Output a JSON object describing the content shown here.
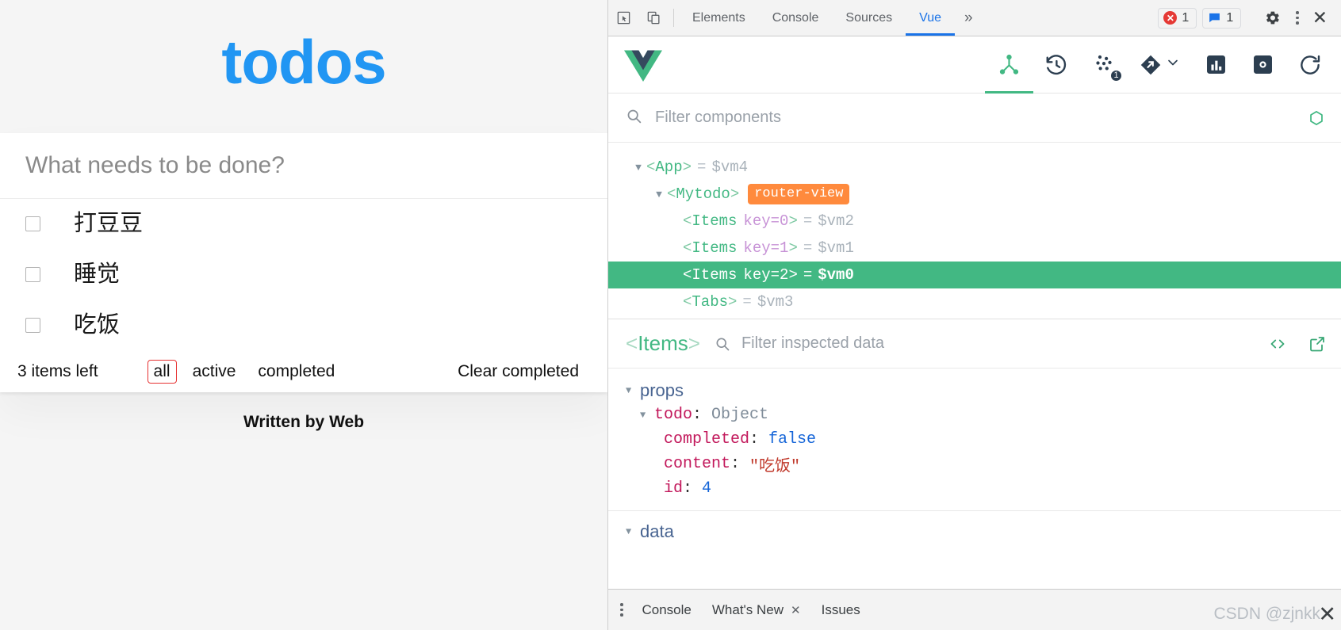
{
  "todo_app": {
    "title": "todos",
    "new_todo_placeholder": "What needs to be done?",
    "items": [
      {
        "label": "打豆豆",
        "completed": false
      },
      {
        "label": "睡觉",
        "completed": false
      },
      {
        "label": "吃饭",
        "completed": false
      }
    ],
    "count_text": "3 items left",
    "filters": [
      {
        "label": "all",
        "selected": true
      },
      {
        "label": "active",
        "selected": false
      },
      {
        "label": "completed",
        "selected": false
      }
    ],
    "clear_completed_label": "Clear completed",
    "written_by": "Written by Web",
    "accent_color": "#2196f3",
    "selected_filter_border": "#e63232"
  },
  "devtools": {
    "topbar": {
      "tabs": [
        {
          "label": "Elements",
          "active": false
        },
        {
          "label": "Console",
          "active": false
        },
        {
          "label": "Sources",
          "active": false
        },
        {
          "label": "Vue",
          "active": true
        }
      ],
      "more_label": "»",
      "error_count": "1",
      "message_count": "1",
      "active_tab_color": "#1a73e8"
    },
    "vue_toolbar": {
      "logo": "vue-logo",
      "buttons": [
        {
          "name": "components-tab",
          "icon": "components-tree-icon",
          "active": true,
          "badge": ""
        },
        {
          "name": "timeline-tab",
          "icon": "history-clock-icon",
          "active": false,
          "badge": ""
        },
        {
          "name": "pinia-tab",
          "icon": "scattered-dots-icon",
          "active": false,
          "badge": "1"
        },
        {
          "name": "routes-tab",
          "icon": "diamond-arrow-icon",
          "active": false,
          "badge": ""
        },
        {
          "name": "performance-tab",
          "icon": "bar-chart-icon",
          "active": false,
          "badge": ""
        },
        {
          "name": "settings-tab",
          "icon": "gear-icon",
          "active": false,
          "badge": ""
        },
        {
          "name": "refresh-button",
          "icon": "refresh-icon",
          "active": false,
          "badge": ""
        }
      ],
      "accent_color": "#42b883"
    },
    "component_filter": {
      "placeholder": "Filter components",
      "search_icon": "search-icon",
      "select_icon": "target-select-icon"
    },
    "tree": [
      {
        "indent": 0,
        "arrow": "▼",
        "name": "App",
        "key": "",
        "vm": "$vm4",
        "badge": "",
        "selected": false
      },
      {
        "indent": 1,
        "arrow": "▼",
        "name": "Mytodo",
        "key": "",
        "vm": "",
        "badge": "router-view",
        "selected": false
      },
      {
        "indent": 2,
        "arrow": "",
        "name": "Items",
        "key": "key=0",
        "vm": "$vm2",
        "badge": "",
        "selected": false
      },
      {
        "indent": 2,
        "arrow": "",
        "name": "Items",
        "key": "key=1",
        "vm": "$vm1",
        "badge": "",
        "selected": false
      },
      {
        "indent": 2,
        "arrow": "",
        "name": "Items",
        "key": "key=2",
        "vm": "$vm0",
        "badge": "",
        "selected": true
      },
      {
        "indent": 2,
        "arrow": "",
        "name": "Tabs",
        "key": "",
        "vm": "$vm3",
        "badge": "",
        "selected": false
      }
    ],
    "inspector": {
      "component_name": "Items",
      "open_bracket": "<",
      "close_bracket": ">",
      "filter_placeholder": "Filter inspected data",
      "search_icon": "search-icon",
      "code_icon": "code-brackets-icon",
      "open_external_icon": "open-in-new-icon",
      "groups": [
        {
          "label": "props",
          "arrow": "▼",
          "rows": [
            {
              "indent": 1,
              "arrow": "▼",
              "key": "todo",
              "colon": ":",
              "value": "Object",
              "vtype": "obj"
            },
            {
              "indent": 2,
              "arrow": "",
              "key": "completed",
              "colon": ":",
              "value": "false",
              "vtype": "bool"
            },
            {
              "indent": 2,
              "arrow": "",
              "key": "content",
              "colon": ":",
              "value": "\"吃饭\"",
              "vtype": "str"
            },
            {
              "indent": 2,
              "arrow": "",
              "key": "id",
              "colon": ":",
              "value": "4",
              "vtype": "num"
            }
          ]
        },
        {
          "label": "data",
          "arrow": "▼",
          "rows": []
        }
      ]
    },
    "drawer": {
      "kebab_icon": "more-vertical-icon",
      "tabs": [
        {
          "label": "Console",
          "closable": false
        },
        {
          "label": "What's New",
          "closable": true
        },
        {
          "label": "Issues",
          "closable": false
        }
      ],
      "close_label": "✕"
    },
    "watermark": "CSDN @zjnkk"
  }
}
